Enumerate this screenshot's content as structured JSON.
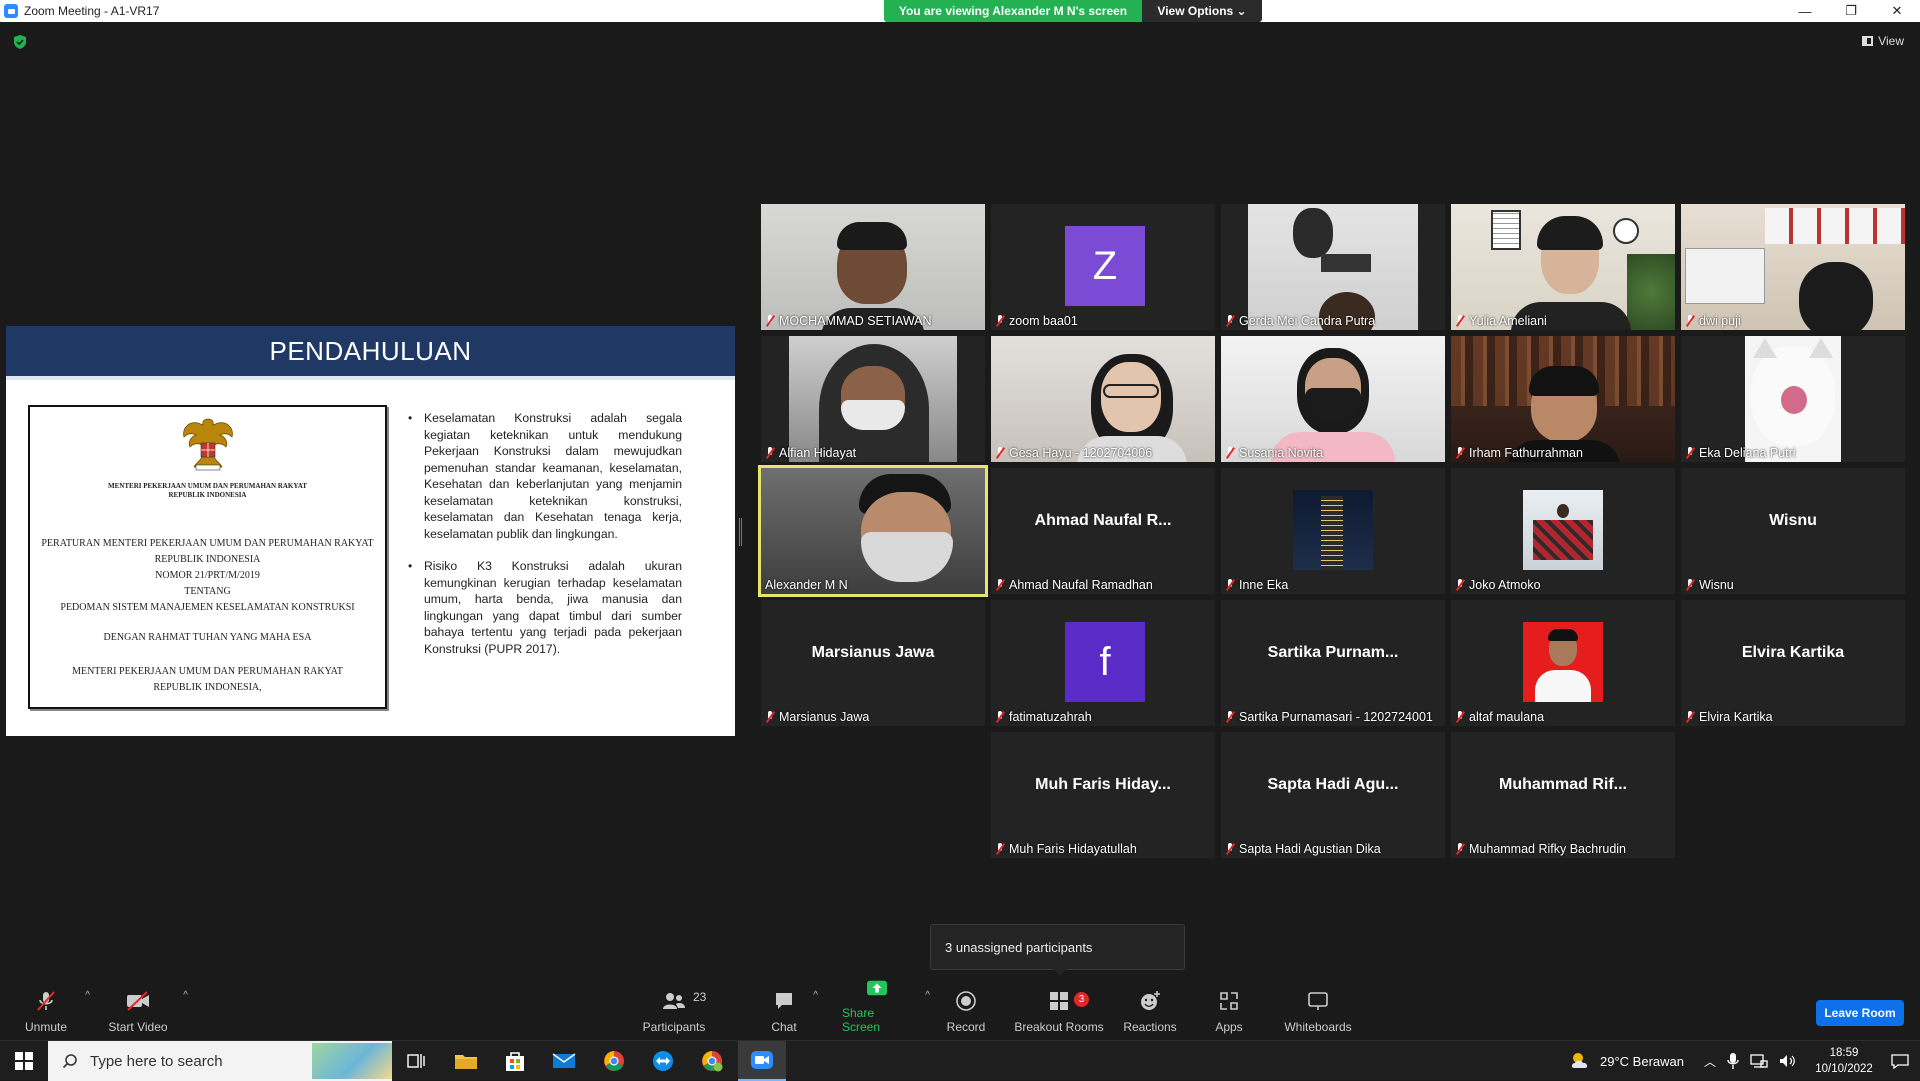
{
  "window": {
    "title": "Zoom Meeting - A1-VR17",
    "minimize": "—",
    "maximize": "❐",
    "close": "✕"
  },
  "banner": {
    "viewing_text": "You are viewing Alexander M N's screen",
    "view_options_label": "View Options ⌄"
  },
  "view_button_label": "View",
  "slide": {
    "title": "PENDAHULUAN",
    "document": {
      "header": "MENTERI PEKERJAAN UMUM DAN PERUMAHAN RAKYAT\nREPUBLIK INDONESIA",
      "line1": "PERATURAN MENTERI PEKERJAAN UMUM DAN PERUMAHAN RAKYAT",
      "line2": "REPUBLIK INDONESIA",
      "line3": "NOMOR 21/PRT/M/2019",
      "line4": "TENTANG",
      "line5": "PEDOMAN SISTEM MANAJEMEN KESELAMATAN KONSTRUKSI",
      "line6": "DENGAN RAHMAT TUHAN YANG MAHA ESA",
      "line7": "MENTERI PEKERJAAN UMUM DAN PERUMAHAN RAKYAT",
      "line8": "REPUBLIK INDONESIA,"
    },
    "bullets": [
      "Keselamatan Konstruksi adalah segala kegiatan keteknikan untuk mendukung Pekerjaan Konstruksi dalam mewujudkan pemenuhan standar keamanan, keselamatan, Kesehatan dan keberlanjutan yang menjamin keselamatan keteknikan konstruksi, keselamatan dan Kesehatan tenaga kerja, keselamatan publik dan lingkungan.",
      "Risiko K3 Konstruksi adalah ukuran kemungkinan kerugian terhadap keselamatan umum, harta benda, jiwa manusia dan lingkungan yang dapat timbul dari sumber bahaya tertentu yang terjadi pada pekerjaan Konstruksi (PUPR 2017)."
    ]
  },
  "participants": [
    {
      "name": "MOCHAMMAD SETIAWAN",
      "big": ""
    },
    {
      "name": "zoom baa01",
      "big": "",
      "letter": "Z"
    },
    {
      "name": "Gerda Mei Candra Putra",
      "big": ""
    },
    {
      "name": "Yulia Ameliani",
      "big": ""
    },
    {
      "name": "dwi puji",
      "big": ""
    },
    {
      "name": "Alfian Hidayat",
      "big": ""
    },
    {
      "name": "Gesa Hayu - 1202704006",
      "big": ""
    },
    {
      "name": "Susania Novita",
      "big": ""
    },
    {
      "name": "Irham Fathurrahman",
      "big": ""
    },
    {
      "name": "Eka Deliana Putri",
      "big": ""
    },
    {
      "name": "Alexander M N",
      "big": ""
    },
    {
      "name": "Ahmad Naufal Ramadhan",
      "big": "Ahmad Naufal R..."
    },
    {
      "name": "Inne Eka",
      "big": ""
    },
    {
      "name": "Joko Atmoko",
      "big": ""
    },
    {
      "name": "Wisnu",
      "big": "Wisnu"
    },
    {
      "name": "Marsianus Jawa",
      "big": "Marsianus Jawa"
    },
    {
      "name": "fatimatuzahrah",
      "big": "",
      "letter": "f"
    },
    {
      "name": "Sartika Purnamasari - 1202724001",
      "big": "Sartika Purnam..."
    },
    {
      "name": "altaf maulana",
      "big": ""
    },
    {
      "name": "Elvira Kartika",
      "big": "Elvira Kartika"
    },
    {
      "name": "Muh Faris Hidayatullah",
      "big": "Muh Faris Hiday..."
    },
    {
      "name": "Sapta Hadi Agustian Dika",
      "big": "Sapta Hadi Agu..."
    },
    {
      "name": "Muhammad Rifky Bachrudin",
      "big": "Muhammad Rif..."
    }
  ],
  "unassigned_text": "3 unassigned participants",
  "toolbar": {
    "unmute": "Unmute",
    "start_video": "Start Video",
    "participants": "Participants",
    "participants_count": "23",
    "chat": "Chat",
    "share_screen": "Share Screen",
    "record": "Record",
    "breakout_rooms": "Breakout Rooms",
    "breakout_badge": "3",
    "reactions": "Reactions",
    "apps": "Apps",
    "whiteboards": "Whiteboards",
    "leave_room": "Leave Room",
    "caret": "^"
  },
  "taskbar": {
    "search_placeholder": "Type here to search",
    "weather": "29°C Berawan",
    "time": "18:59",
    "date": "10/10/2022"
  },
  "colors": {
    "banner_green": "#23b152",
    "slide_header": "#1f3864",
    "speaker_border": "#e8e46a",
    "leave_blue": "#0e71eb",
    "mute_red": "#e02828",
    "zoom_purple": "#7b4bd6",
    "fatima_purple": "#5b2bc8"
  }
}
